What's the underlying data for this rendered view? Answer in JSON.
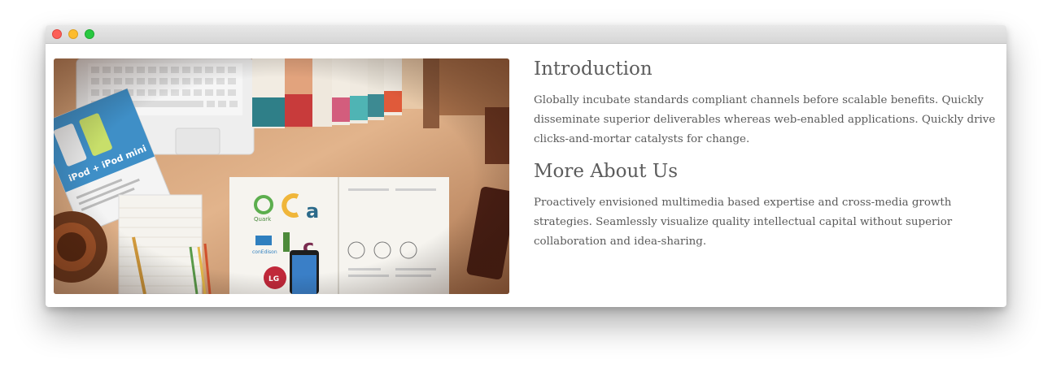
{
  "window": {
    "controls": [
      "close",
      "minimize",
      "zoom"
    ]
  },
  "hero": {
    "description_icon": "desk-photo",
    "logos": [
      "Quark",
      "conEdison",
      "LG"
    ],
    "booklet_text": "iPod + iPod mini"
  },
  "sections": [
    {
      "title": "Introduction",
      "body": "Globally incubate standards compliant channels before scalable benefits. Quickly disseminate superior deliverables whereas web-enabled applications. Quickly drive clicks-and-mortar catalysts for change."
    },
    {
      "title": "More About Us",
      "body": "Proactively envisioned multimedia based expertise and cross-media growth strategies. Seamlessly visualize quality intellectual capital without superior collaboration and idea-sharing."
    }
  ]
}
